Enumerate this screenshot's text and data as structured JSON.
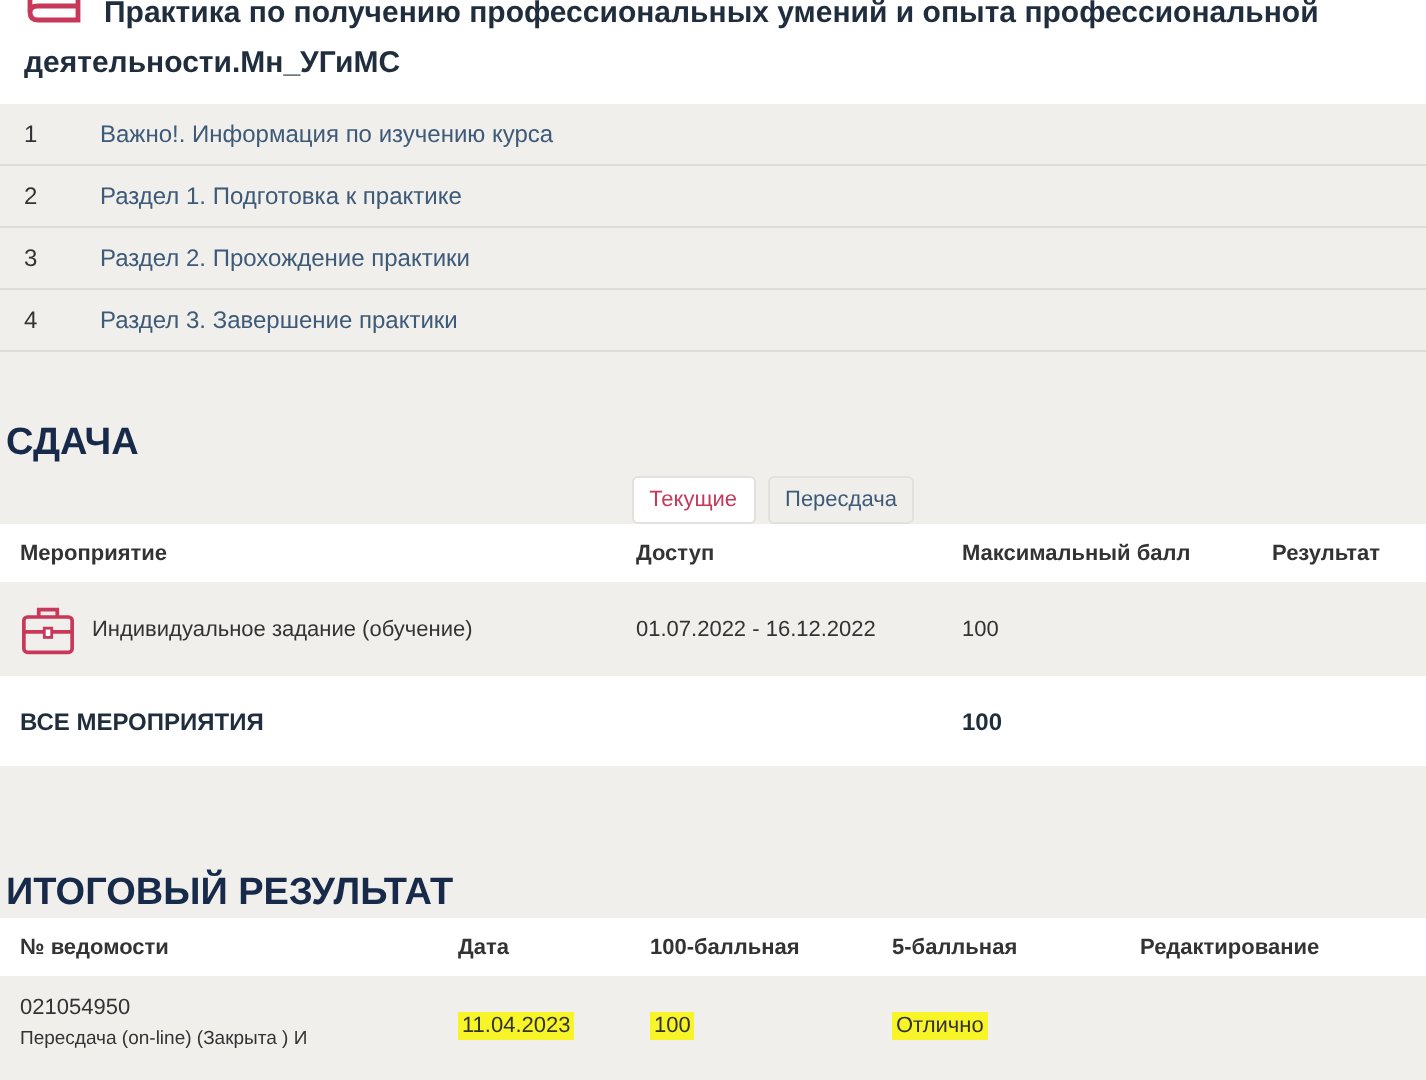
{
  "course": {
    "title_lines": [
      "Практика по получению профессиональных умений и опыта профессиональной",
      "деятельности.Мн_УГиМС"
    ],
    "sections": [
      {
        "number": "1",
        "title": "Важно!. Информация по изучению курса"
      },
      {
        "number": "2",
        "title": "Раздел 1. Подготовка к практике"
      },
      {
        "number": "3",
        "title": "Раздел 2. Прохождение практики"
      },
      {
        "number": "4",
        "title": "Раздел 3. Завершение практики"
      }
    ]
  },
  "submission": {
    "heading": "СДАЧА",
    "tabs": [
      {
        "label": "Текущие",
        "selected": true
      },
      {
        "label": "Пересдача",
        "selected": false
      }
    ],
    "columns": [
      "Мероприятие",
      "Доступ",
      "Максимальный балл",
      "Результат"
    ],
    "rows": [
      {
        "activity": "Индивидуальное задание (обучение)",
        "access": "01.07.2022 - 16.12.2022",
        "max_score": "100"
      }
    ],
    "total": {
      "label": "ВСЕ МЕРОПРИЯТИЯ",
      "max_score": "100"
    }
  },
  "final_result": {
    "heading": "ИТОГОВЫЙ РЕЗУЛЬТАТ",
    "columns": [
      "№ ведомости",
      "Дата",
      "100-балльная",
      "5-балльная",
      "Редактирование"
    ],
    "rows": [
      {
        "cells": [
          {
            "text": "021054950",
            "note": "Пересдача (on-line) (Закрыта ) И",
            "highlighted": false
          },
          {
            "text": "11.04.2023",
            "highlighted": true
          },
          {
            "text": "100",
            "highlighted": true
          },
          {
            "text": "Отлично",
            "highlighted": true
          }
        ]
      }
    ]
  }
}
